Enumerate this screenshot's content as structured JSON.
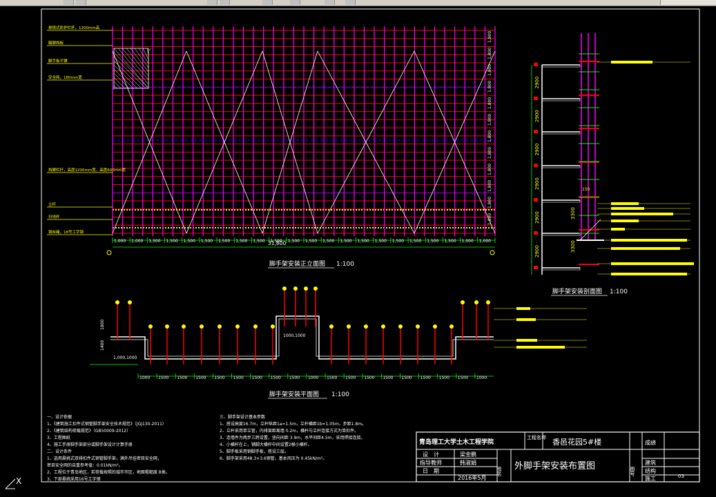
{
  "colors": {
    "magenta": "#ff00ff",
    "red": "#ff0000",
    "yellow": "#ffff00",
    "white": "#ffffff",
    "green": "#00ff00",
    "blue": "#0000ff",
    "cyan": "#00ffff",
    "frame": "#ffffff"
  },
  "elevation": {
    "title": "脚手架安装正立面图",
    "scale": "1:100",
    "total_dim": "31,800",
    "bay_dims": [
      "1,000",
      "1,000",
      "1,500",
      "1,500",
      "1,500",
      "1,500",
      "1,500",
      "1,500",
      "1,500",
      "1,500",
      "1,500",
      "1,500",
      "1,500",
      "1,500",
      "1,500",
      "1,500",
      "1,500",
      "1,500",
      "1,500",
      "1,500",
      "1,000",
      "1,000"
    ],
    "callouts": [
      "悬挑式防护栏杆，1200mm高",
      "踢脚挡板",
      "脚手板平铺",
      "安全网，180mm宽",
      "挡脚栏杆，高度1200mm宽，高度600mm宽",
      "立杆",
      "扫地杆",
      "钢丝绳，18号工字钢"
    ]
  },
  "section": {
    "title": "脚手架安装剖面图",
    "scale": "1:100",
    "dims": [
      "2900",
      "2900",
      "2900",
      "2900",
      "2900",
      "2900"
    ],
    "dim_bottom": [
      "3300",
      "3300"
    ],
    "top_dim": "150"
  },
  "plan": {
    "title": "脚手架安装平面图",
    "scale": "1:100",
    "left_dims": [
      "1800",
      "1400"
    ],
    "mid_dim": "1000,1000",
    "low_left": "1,000,1000",
    "bay_dims": [
      "1000",
      "1500",
      "1500",
      "1500",
      "1500",
      "1500",
      "1500",
      "1500",
      "1500",
      "1000",
      "1500",
      "1500",
      "1500",
      "1500",
      "1500",
      "1500",
      "1500",
      "1500",
      "1000"
    ]
  },
  "notes": {
    "col1": [
      "一、设计依据",
      "1、《建筑施工扣件式钢管脚手架安全技术规范》（JGJ130-2011）",
      "2、《建筑结构荷载规范》（GB50009-2012）",
      "3、工程图纸",
      "4、施工手册脚手架部分或脚手架设计计算手册",
      "二、设计条件",
      "1、选用悬挑式双排扣件式钢管脚手架，满外吊挂密目安全网，",
      "密目安全网的自重参考值：0.01kN/m²。",
      "2、工程位于青岛地区，若荷载按照的城市市区，地面粗糙度 B类。",
      "3、下部悬挑采用16号工字钢"
    ],
    "col2": [
      "三、脚手架设计基本参数",
      "1、搭设高度16.7m，立杆纵距1a=1.5m，立杆横距1b=1.05m，步距1.8m。",
      "2、立杆采用单立管，内排架距离墙 0.2m，横杆与立杆连接方式为单扣件。",
      "3、连墙件为两步三跨设置，竖向间距 3.9m，水平间距4.5m，采用焊接连接。",
      "4、小横杆在上，铺脚大横杆中间设置2根小横杆。",
      "5、脚手板采用钢脚手板，搭设三层。",
      "6、脚手架采用48.3×3.6钢管，基本风压为 0.45kN/m²。"
    ]
  },
  "titleblock": {
    "school": "青岛理工大学土木工程学院",
    "project_label": "工程名称",
    "project": "香邑花园5#楼",
    "score": "成绩",
    "design_label": "设　计",
    "designer": "梁金鹏",
    "advisor_label": "指导教师",
    "advisor": "韩淑娟",
    "date_label": "日　期",
    "date": "2016年5月",
    "drawing_label": "图名",
    "drawing": "外脚手架安装布置图",
    "no_label": "图号",
    "discipline1": "建筑",
    "discipline2": "结构",
    "discipline3": "施工",
    "sheet": "03"
  },
  "ucs": "X"
}
